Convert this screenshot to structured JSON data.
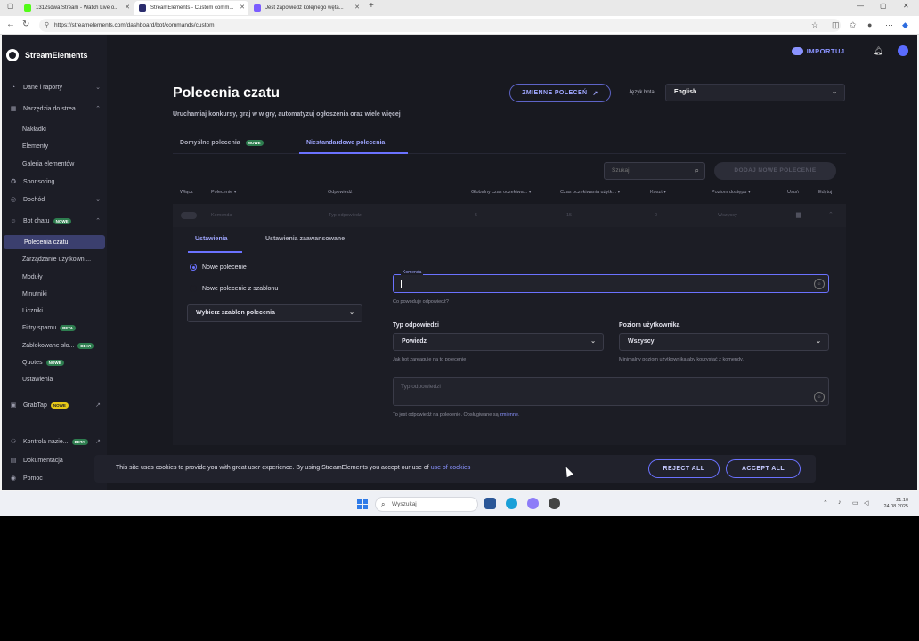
{
  "browser": {
    "tabs": [
      {
        "title": "1312sdwa Stream - Watch Live o...",
        "color": "#53fc18"
      },
      {
        "title": "StreamElements - Custom comm...",
        "color": "#2b2d6e"
      },
      {
        "title": "Jest zapowiedź kolejnego węta...",
        "color": "#7b5cff"
      }
    ],
    "url": "https://streamelements.com/dashboard/bot/commands/custom"
  },
  "sidebar": {
    "brand": "StreamElements",
    "items": [
      {
        "label": "Dane i raporty",
        "icon": "chart-icon",
        "glyph": "◔",
        "chev": "⌄"
      },
      {
        "label": "Narzędzia do strea...",
        "icon": "tools-icon",
        "glyph": "▦",
        "chev": "⌃"
      },
      {
        "label": "Nakładki",
        "sub": true
      },
      {
        "label": "Elementy",
        "sub": true
      },
      {
        "label": "Galeria elementów",
        "sub": true
      },
      {
        "label": "Sponsoring",
        "icon": "star-icon",
        "glyph": "✪"
      },
      {
        "label": "Dochód",
        "icon": "money-icon",
        "glyph": "◎",
        "chev": "⌄"
      },
      {
        "label": "Bot chatu",
        "icon": "bot-icon",
        "glyph": "☺",
        "badge": "NOWE",
        "chev": "⌃"
      },
      {
        "label": "Polecenia czatu",
        "sub": true,
        "active": true
      },
      {
        "label": "Zarządzanie użytkowni...",
        "sub": true
      },
      {
        "label": "Moduły",
        "sub": true
      },
      {
        "label": "Minutniki",
        "sub": true
      },
      {
        "label": "Liczniki",
        "sub": true
      },
      {
        "label": "Filtry spamu",
        "sub": true,
        "badge": "BETA"
      },
      {
        "label": "Zablokowane sło...",
        "sub": true,
        "badge": "BETA"
      },
      {
        "label": "Quotes",
        "sub": true,
        "badge": "NOWE"
      },
      {
        "label": "Ustawienia",
        "sub": true
      },
      {
        "label": "GrabTap",
        "icon": "grabtap-icon",
        "glyph": "▣",
        "badge": "NOWE",
        "badgeYellow": true,
        "ext": "↗"
      },
      {
        "label": "Kontrola nazie...",
        "icon": "parental-icon",
        "glyph": "⚇",
        "badge": "BETA",
        "ext": "↗"
      },
      {
        "label": "Dokumentacja",
        "icon": "docs-icon",
        "glyph": "▤"
      },
      {
        "label": "Pomoc",
        "icon": "help-icon",
        "glyph": "◉"
      }
    ]
  },
  "header": {
    "import_label": "IMPORTUJ",
    "title": "Polecenia czatu",
    "subtitle": "Uruchamiaj konkursy, graj w w gry, automatyzuj ogłoszenia oraz wiele więcej",
    "vars_label": "ZMIENNE POLECEŃ",
    "lang_label": "Język bota",
    "lang_value": "English"
  },
  "tabs": {
    "default_label": "Domyślne polecenia",
    "default_badge": "NOWE",
    "custom_label": "Niestandardowe polecenia"
  },
  "toolbar": {
    "search_placeholder": "Szukaj",
    "add_label": "DODAJ NOWE POLECENIE"
  },
  "table": {
    "headers": [
      "Włącz",
      "Polecenie",
      "Odpowiedź",
      "Globalny czas oczekiwa...",
      "Czas oczekiwania użytk...",
      "Koszt",
      "Poziom dostępu",
      "Usuń",
      "Edytuj"
    ],
    "row": {
      "command": "Komenda",
      "response": "Typ odpowiedzi",
      "global_cd": "5",
      "user_cd": "15",
      "cost": "0",
      "level": "Wszyscy"
    }
  },
  "editor": {
    "tab_settings": "Ustawienia",
    "tab_advanced": "Ustawienia zaawansowane",
    "radio_new": "Nowe polecenie",
    "radio_template": "Nowe polecenie z szablonu",
    "template_select": "Wybierz szablon polecenia",
    "command_label": "Komenda",
    "command_hint": "Co powoduje odpowiedź?",
    "response_type_label": "Typ odpowiedzi",
    "response_type_value": "Powiedz",
    "response_type_hint": "Jak bot zareaguje na to polecenie",
    "user_level_label": "Poziom użytkownika",
    "user_level_value": "Wszyscy",
    "user_level_hint": "Minimalny poziom użytkownika aby korzystać z komendy.",
    "response_placeholder": "Typ odpowiedzi",
    "response_hint_prefix": "To jest odpowiedź na polecenie. Obsługiwane są",
    "response_hint_link": "zmienne",
    "response_hint_suffix": "."
  },
  "cookie": {
    "message": "This site uses cookies to provide you with great user experience. By using StreamElements you accept our use of",
    "link": "use of cookies",
    "reject": "REJECT ALL",
    "accept": "ACCEPT ALL"
  },
  "taskbar": {
    "search_placeholder": "Wyszukaj",
    "time": "21:10",
    "date": "24.08.2025"
  }
}
